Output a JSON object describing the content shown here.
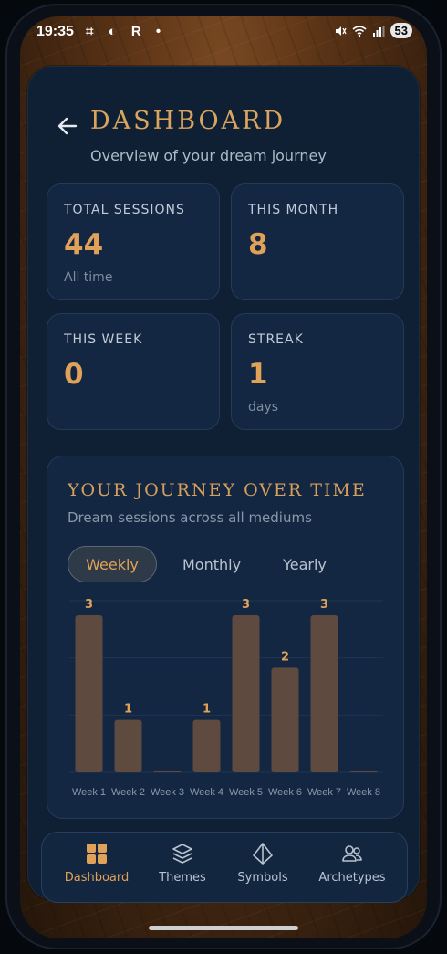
{
  "status_bar": {
    "time": "19:35",
    "left_icons": "⌗ ◐ R •",
    "battery": "53"
  },
  "header": {
    "title": "DASHBOARD",
    "subtitle": "Overview of your dream journey"
  },
  "stats": [
    {
      "label": "TOTAL SESSIONS",
      "value": "44",
      "sub": "All time"
    },
    {
      "label": "THIS MONTH",
      "value": "8",
      "sub": ""
    },
    {
      "label": "THIS WEEK",
      "value": "0",
      "sub": ""
    },
    {
      "label": "STREAK",
      "value": "1",
      "sub": "days"
    }
  ],
  "chart_section": {
    "title": "YOUR JOURNEY OVER TIME",
    "subtitle": "Dream sessions across all mediums",
    "tabs": [
      {
        "label": "Weekly",
        "active": true
      },
      {
        "label": "Monthly",
        "active": false
      },
      {
        "label": "Yearly",
        "active": false
      }
    ]
  },
  "chart_data": {
    "type": "bar",
    "categories": [
      "Week 1",
      "Week 2",
      "Week 3",
      "Week 4",
      "Week 5",
      "Week 6",
      "Week 7",
      "Week 8"
    ],
    "values": [
      3,
      1,
      0,
      1,
      3,
      2,
      3,
      0
    ],
    "data_labels": [
      "3",
      "1",
      "",
      "1",
      "3",
      "2",
      "3",
      ""
    ],
    "ylim": [
      0,
      3
    ],
    "grid": true,
    "colors": {
      "bar": "#5e4a3f",
      "label": "#e0a159",
      "tick": "#8a98a9",
      "grid": "#1e3450"
    }
  },
  "bottom_nav": {
    "items": [
      {
        "label": "Dashboard",
        "icon": "grid-icon",
        "active": true
      },
      {
        "label": "Themes",
        "icon": "layers-icon",
        "active": false
      },
      {
        "label": "Symbols",
        "icon": "diamond-icon",
        "active": false
      },
      {
        "label": "Archetypes",
        "icon": "people-icon",
        "active": false
      }
    ]
  },
  "colors": {
    "accent": "#e0a159",
    "panel": "#0f2035",
    "card": "#132742"
  }
}
